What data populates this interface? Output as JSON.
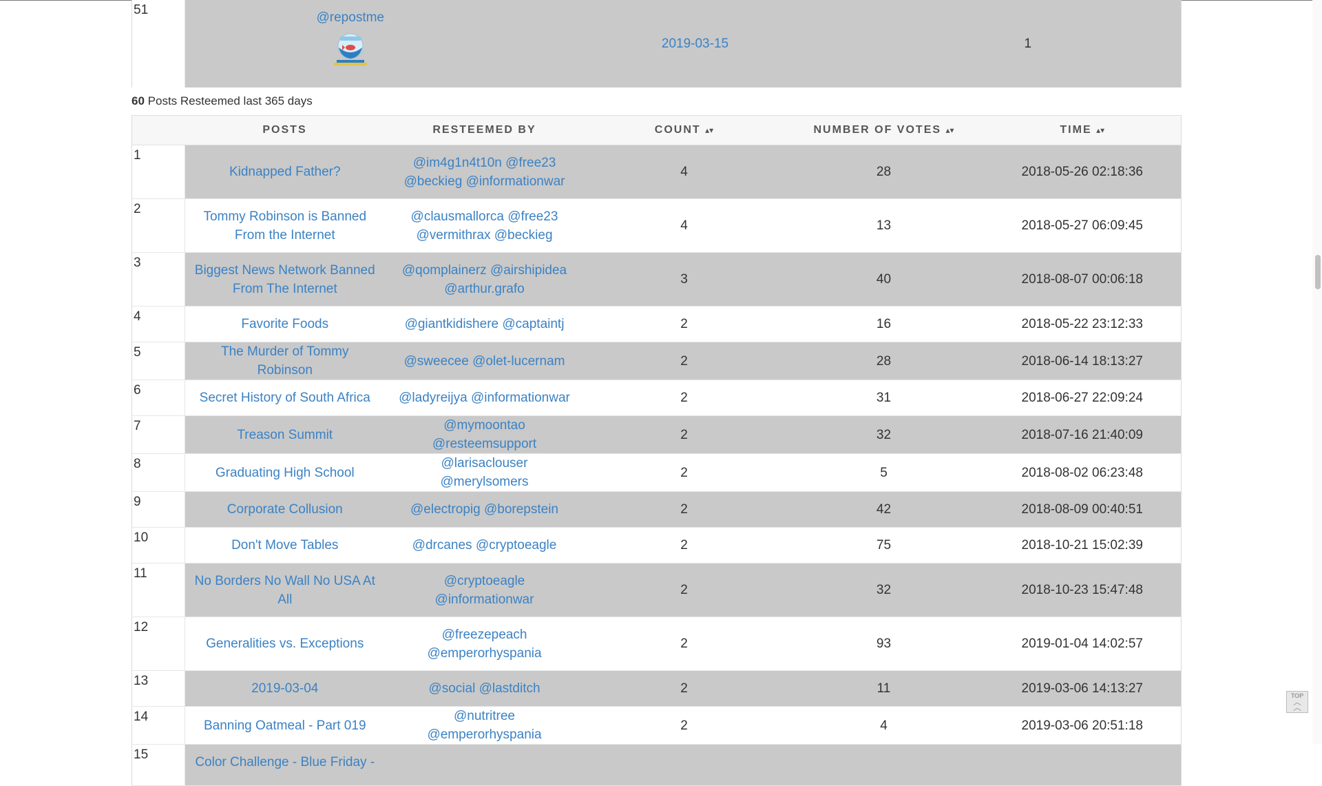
{
  "previous_row": {
    "index": "51",
    "user": "@repostme",
    "date": "2019-03-15",
    "count": "1"
  },
  "summary": {
    "count": "60",
    "text": " Posts Resteemed last 365 days"
  },
  "table": {
    "headers": {
      "posts": "POSTS",
      "resteemed_by": "RESTEEMED BY",
      "count": "COUNT",
      "votes": "NUMBER OF VOTES",
      "time": "TIME",
      "sort_glyph": "▴▾"
    },
    "rows": [
      {
        "n": "1",
        "post": "Kidnapped Father?",
        "by": "@im4g1n4t10n @free23 @beckieg @informationwar",
        "count": "4",
        "votes": "28",
        "time": "2018-05-26 02:18:36"
      },
      {
        "n": "2",
        "post": "Tommy Robinson is Banned From the Internet",
        "by": "@clausmallorca @free23 @vermithrax @beckieg",
        "count": "4",
        "votes": "13",
        "time": "2018-05-27 06:09:45"
      },
      {
        "n": "3",
        "post": "Biggest News Network Banned From The Internet",
        "by": "@qomplainerz @airshipidea @arthur.grafo",
        "count": "3",
        "votes": "40",
        "time": "2018-08-07 00:06:18"
      },
      {
        "n": "4",
        "post": "Favorite Foods",
        "by": "@giantkidishere @captaintj",
        "count": "2",
        "votes": "16",
        "time": "2018-05-22 23:12:33"
      },
      {
        "n": "5",
        "post": "The Murder of Tommy Robinson",
        "by": "@sweecee @olet-lucernam",
        "count": "2",
        "votes": "28",
        "time": "2018-06-14 18:13:27"
      },
      {
        "n": "6",
        "post": "Secret History of South Africa",
        "by": "@ladyreijya @informationwar",
        "count": "2",
        "votes": "31",
        "time": "2018-06-27 22:09:24"
      },
      {
        "n": "7",
        "post": "Treason Summit",
        "by": "@mymoontao @resteemsupport",
        "count": "2",
        "votes": "32",
        "time": "2018-07-16 21:40:09"
      },
      {
        "n": "8",
        "post": "Graduating High School",
        "by": "@larisaclouser @merylsomers",
        "count": "2",
        "votes": "5",
        "time": "2018-08-02 06:23:48"
      },
      {
        "n": "9",
        "post": "Corporate Collusion",
        "by": "@electropig @borepstein",
        "count": "2",
        "votes": "42",
        "time": "2018-08-09 00:40:51"
      },
      {
        "n": "10",
        "post": "Don't Move Tables",
        "by": "@drcanes @cryptoeagle",
        "count": "2",
        "votes": "75",
        "time": "2018-10-21 15:02:39"
      },
      {
        "n": "11",
        "post": "No Borders No Wall No USA At All",
        "by": "@cryptoeagle @informationwar",
        "count": "2",
        "votes": "32",
        "time": "2018-10-23 15:47:48"
      },
      {
        "n": "12",
        "post": "Generalities vs. Exceptions",
        "by": "@freezepeach @emperorhyspania",
        "count": "2",
        "votes": "93",
        "time": "2019-01-04 14:02:57"
      },
      {
        "n": "13",
        "post": "2019-03-04",
        "by": "@social @lastditch",
        "count": "2",
        "votes": "11",
        "time": "2019-03-06 14:13:27"
      },
      {
        "n": "14",
        "post": "Banning Oatmeal - Part 019",
        "by": "@nutritree @emperorhyspania",
        "count": "2",
        "votes": "4",
        "time": "2019-03-06 20:51:18"
      },
      {
        "n": "15",
        "post": "Color Challenge - Blue Friday -",
        "by": "",
        "count": "",
        "votes": "",
        "time": ""
      }
    ]
  },
  "top_button": {
    "label": "TOP"
  }
}
